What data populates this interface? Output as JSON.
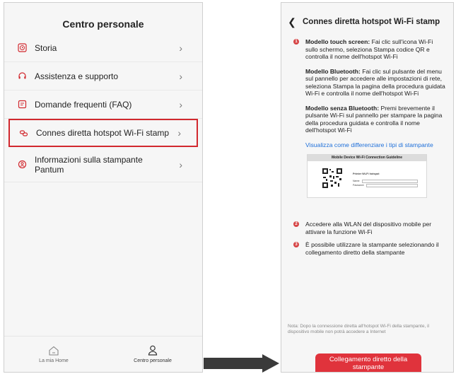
{
  "left_screen": {
    "title": "Centro personale",
    "items": [
      {
        "label": "Storia",
        "icon": "clock-icon"
      },
      {
        "label": "Assistenza e supporto",
        "icon": "headset-icon"
      },
      {
        "label": "Domande frequenti (FAQ)",
        "icon": "faq-icon"
      },
      {
        "label": "Connes diretta hotspot Wi-Fi stamp",
        "icon": "link-icon",
        "highlighted": true
      },
      {
        "label_line1": "Informazioni sulla stampante",
        "label_line2": "Pantum",
        "icon": "info-icon"
      }
    ],
    "nav": [
      {
        "label": "La mia Home",
        "icon": "home-icon"
      },
      {
        "label": "Centro personale",
        "icon": "user-icon",
        "active": true
      }
    ]
  },
  "right_screen": {
    "title": "Connes diretta hotspot Wi-Fi stamp",
    "step1": {
      "number": "1",
      "p1_bold": "Modello touch screen:",
      "p1_text": " Fai clic sull'icona Wi-Fi sullo schermo, seleziona Stampa codice QR e controlla il nome dell'hotspot Wi-Fi",
      "p2_bold": "Modello Bluetooth:",
      "p2_text": " Fai clic sul pulsante del menu sul pannello per accedere alle impostazioni di rete, seleziona Stampa la pagina della procedura guidata Wi-Fi e controlla il nome dell'hotspot Wi-Fi",
      "p3_bold": "Modello senza Bluetooth:",
      "p3_text": " Premi brevemente il pulsante Wi-Fi sul pannello per stampare la pagina della procedura guidata e controlla il nome dell'hotspot Wi-Fi",
      "link": "Visualizza come differenziare i tipi di stampante",
      "guide_title": "Mobile Device Wi-Fi Connection Guideline",
      "guide_form_title": "Printer Wi-Fi hotspot",
      "guide_name_label": "Name:",
      "guide_password_label": "Password:"
    },
    "step2": {
      "number": "2",
      "text": "Accedere alla WLAN del dispositivo mobile per attivare la funzione Wi-Fi"
    },
    "step3": {
      "number": "3",
      "text": "È possibile utilizzare la stampante selezionando il collegamento diretto della stampante"
    },
    "note": "Nota: Dopo la connessione diretta all'hotspot Wi-Fi della stampante, il dispositivo mobile non potrà accedere a Internet",
    "cta_line1": "Collegamento diretto della",
    "cta_line2": "stampante"
  },
  "colors": {
    "accent": "#e0333c",
    "link": "#1e6fd9",
    "highlight_border": "#d1282e"
  }
}
